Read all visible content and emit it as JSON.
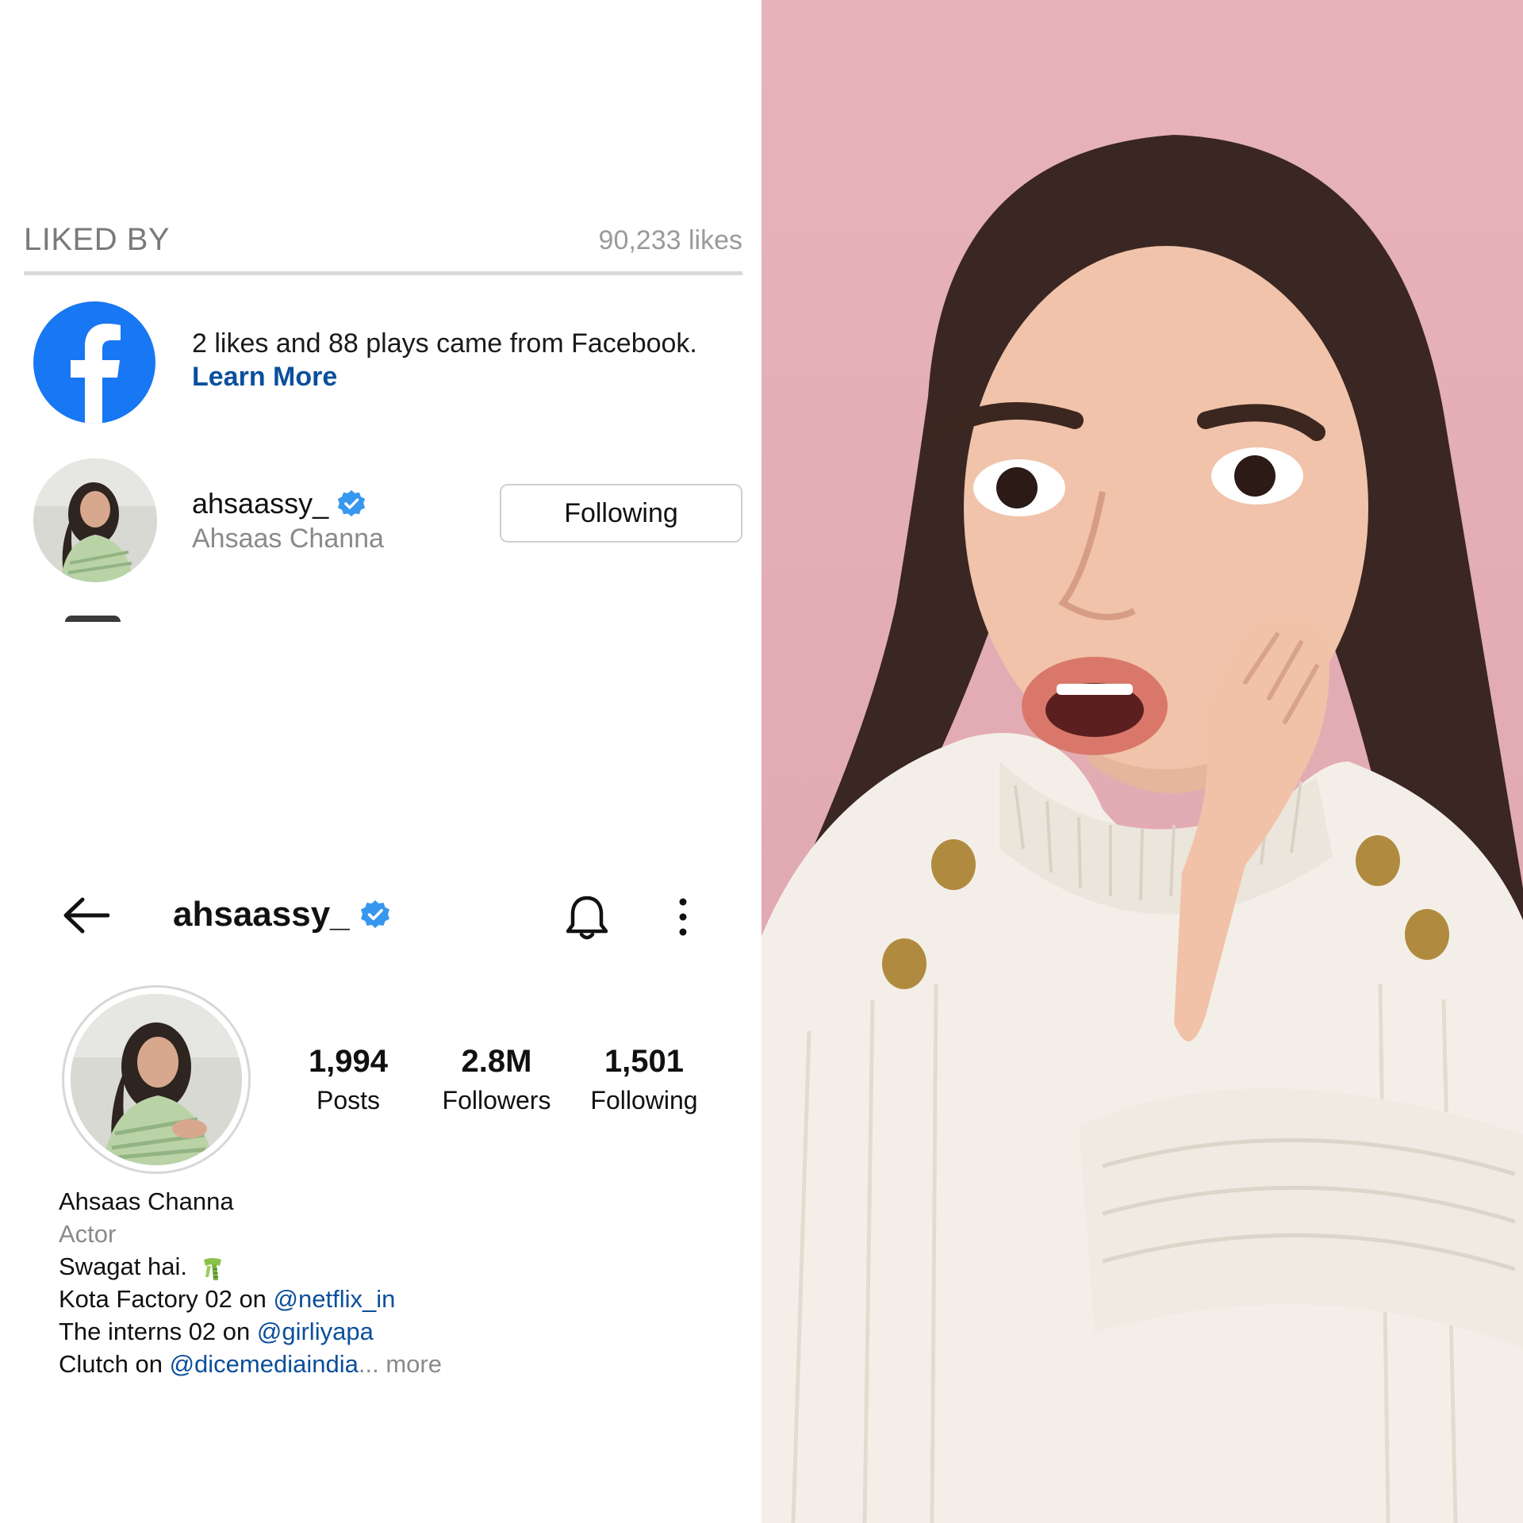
{
  "liked_by": {
    "title": "LIKED BY",
    "likes_count": "90,233 likes",
    "facebook_notice": "2 likes and 88 plays came from Facebook.",
    "learn_more": "Learn More",
    "user": {
      "username": "ahsaassy_",
      "full_name": "Ahsaas Channa",
      "follow_button": "Following",
      "verified": true
    }
  },
  "profile": {
    "username": "ahsaassy_",
    "verified": true,
    "stats": [
      {
        "value": "1,994",
        "label": "Posts"
      },
      {
        "value": "2.8M",
        "label": "Followers"
      },
      {
        "value": "1,501",
        "label": "Following"
      }
    ],
    "bio": {
      "name": "Ahsaas Channa",
      "category": "Actor",
      "line1": "Swagat hai.",
      "line2_text": "Kota Factory 02 on ",
      "line2_link": "@netflix_in",
      "line3_text": "The interns 02 on ",
      "line3_link": "@girliyapa",
      "line4_text": "Clutch on ",
      "line4_link": "@dicemediaindia",
      "ellipsis": "...",
      "more": " more"
    }
  },
  "colors": {
    "facebook_blue": "#1877f2",
    "verified_blue": "#3797f0",
    "link_blue": "#0b4f9c",
    "pink_background": "#e4adb4"
  },
  "icons": [
    "facebook-icon",
    "verified-icon",
    "back-arrow-icon",
    "bell-icon",
    "more-options-icon",
    "scarf-emoji"
  ]
}
